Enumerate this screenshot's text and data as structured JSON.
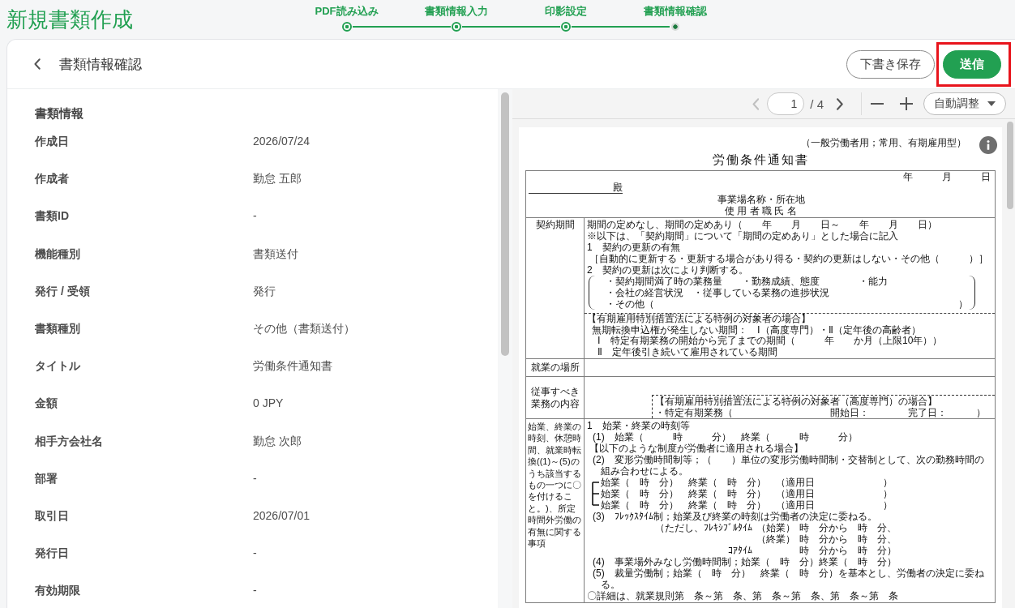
{
  "app_header": {
    "title": "新規書類作成"
  },
  "steps": [
    {
      "label": "PDF読み込み",
      "completed": true,
      "current": false
    },
    {
      "label": "書類情報入力",
      "completed": true,
      "current": false
    },
    {
      "label": "印影設定",
      "completed": true,
      "current": false
    },
    {
      "label": "書類情報確認",
      "completed": false,
      "current": true
    }
  ],
  "page_header": {
    "title": "書類情報確認",
    "actions": [
      {
        "label": "下書き保存",
        "kind": "outline",
        "highlighted": false
      },
      {
        "label": "送信",
        "kind": "primary",
        "highlighted": true
      }
    ]
  },
  "info_panel": {
    "section_title": "書類情報",
    "fields": [
      {
        "label": "作成日",
        "value": "2026/07/24"
      },
      {
        "label": "作成者",
        "value": "勤怠 五郎"
      },
      {
        "label": "書類ID",
        "value": "-"
      },
      {
        "label": "機能種別",
        "value": "書類送付"
      },
      {
        "label": "発行 / 受領",
        "value": "発行"
      },
      {
        "label": "書類種別",
        "value": "その他（書類送付）"
      },
      {
        "label": "タイトル",
        "value": "労働条件通知書"
      },
      {
        "label": "金額",
        "value": "0 JPY"
      },
      {
        "label": "相手方会社名",
        "value": "勤怠 次郎"
      },
      {
        "label": "部署",
        "value": "-"
      },
      {
        "label": "取引日",
        "value": "2026/07/01"
      },
      {
        "label": "発行日",
        "value": "-"
      },
      {
        "label": "有効期限",
        "value": "-"
      }
    ]
  },
  "viewer": {
    "toolbar": {
      "prev_disabled": true,
      "next_disabled": false,
      "page": "1",
      "page_total": "/ 4",
      "zoom": "自動調整"
    },
    "document": {
      "form_type": "（一般労働者用；常用、有期雇用型）",
      "title": "労働条件通知書",
      "date_line": "年　　　月　　　日",
      "addressee": "殿",
      "employer_lines": [
        "事業場名称・所在地",
        "使 用 者 職 氏 名"
      ],
      "rows": [
        {
          "kind": "contract",
          "heading": "契約期間",
          "blocks": [
            {
              "kind": "line",
              "text": "期間の定めなし、期間の定めあり（　　年　　月　　日～　　年　　月　　日）"
            },
            {
              "kind": "line",
              "text": "※以下は、「契約期間」について「期間の定めあり」とした場合に記入"
            },
            {
              "kind": "line",
              "text": "1　契約の更新の有無"
            },
            {
              "kind": "indent",
              "text": "［自動的に更新する・更新する場合があり得る・契約の更新はしない・その他（　　　）］"
            },
            {
              "kind": "line",
              "text": "2　契約の更新は次により判断する。"
            },
            {
              "kind": "bracket",
              "items": [
                {
                  "text": "・契約期間満了時の業務量　　・勤務成績、態度　　　　・能力"
                },
                {
                  "text": "・会社の経営状況　・従事している業務の進捗状況"
                },
                {
                  "text": "・その他（",
                  "end": "）"
                }
              ]
            },
            {
              "kind": "note",
              "lines": [
                {
                  "kind": "title",
                  "text": "【有期雇用特別措置法による特例の対象者の場合】"
                },
                {
                  "kind": "line",
                  "text": "無期転換申込権が発生しない期間：　Ⅰ（高度専門）・Ⅱ（定年後の高齢者）"
                },
                {
                  "kind": "item",
                  "text": "Ⅰ　特定有期業務の開始から完了までの期間（　　　年　　か月（上限10年））"
                },
                {
                  "kind": "item",
                  "text": "Ⅱ　定年後引き続いて雇用されている期間"
                }
              ]
            }
          ]
        },
        {
          "kind": "place",
          "heading": "就業の場所"
        },
        {
          "kind": "duties",
          "heading": "従事すべき業務の内容",
          "blocks": [
            {
              "kind": "notebox",
              "lines": [
                "【有期雇用特別措置法による特例の対象者（高度専門）の場合】",
                "・特定有期業務（　　　　　　　　　　開始日：　　　　完了日：　　　）"
              ]
            }
          ]
        },
        {
          "kind": "hours",
          "heading": "始業、終業の時刻、休憩時間、就業時転換((1)～(5)のうち該当するもの一つに〇を付けること。)、所定時間外労働の有無に関する事項",
          "blocks": [
            {
              "kind": "line",
              "text": "1　始業・終業の時刻等"
            },
            {
              "kind": "numbered",
              "text": "(1)　始業（　　　時　　　分）　終業（　　　時　　　分）"
            },
            {
              "kind": "indent",
              "text": "【以下のような制度が労働者に適用される場合】"
            },
            {
              "kind": "numbered",
              "text": "(2)　変形労働時間制等；（　　）単位の変形労働時間制・交替制として、次の勤務時間の組み合わせによる。"
            },
            {
              "kind": "shifts",
              "items": [
                "始業（　時　分）　終業（　時　分）　（適用日　　　　　　　）",
                "始業（　時　分）　終業（　時　分）　（適用日　　　　　　　）",
                "始業（　時　分）　終業（　時　分）　（適用日　　　　　　　）"
              ]
            },
            {
              "kind": "numbered",
              "text": "(3)　ﾌﾚｯｸｽﾀｲﾑ制；始業及び終業の時刻は労働者の決定に委ねる。"
            },
            {
              "kind": "flex",
              "rows": [
                {
                  "prefix": "（ただし、ﾌﾚｷｼﾌﾞﾙﾀｲﾑ",
                  "label": "（始業）",
                  "times": "時　分から　時　分、"
                },
                {
                  "label": "（終業）",
                  "times": "時　分から　時　分、"
                },
                {
                  "prefix": "ｺｱﾀｲﾑ",
                  "times": "時　分から　時　分）"
                }
              ]
            },
            {
              "kind": "numbered",
              "text": "(4)　事業場外みなし労働時間制；始業（　時　分）終業（　時　分）"
            },
            {
              "kind": "numbered",
              "text": "(5)　裁量労働制；始業（　時　分）　終業（　時　分）を基本とし、労働者の決定に委ねる。"
            },
            {
              "kind": "line",
              "text": "〇詳細は、就業規則第　条～第　条、第　条～第　条、第　条～第　条"
            }
          ]
        }
      ]
    }
  }
}
